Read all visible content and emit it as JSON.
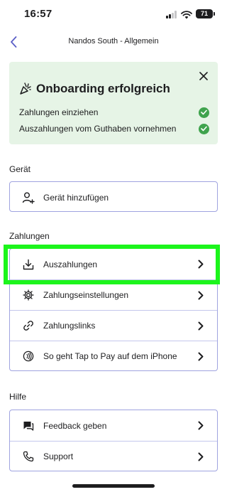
{
  "status_bar": {
    "time": "16:57",
    "battery": "71"
  },
  "nav": {
    "title": "Nandos South - Allgemein"
  },
  "onboarding": {
    "title": "Onboarding erfolgreich",
    "items": [
      {
        "label": "Zahlungen einziehen"
      },
      {
        "label": "Auszahlungen vom Guthaben vornehmen"
      }
    ]
  },
  "sections": {
    "device": {
      "title": "Gerät",
      "items": [
        {
          "label": "Gerät hinzufügen",
          "icon": "add-person-icon"
        }
      ]
    },
    "payments": {
      "title": "Zahlungen",
      "items": [
        {
          "label": "Auszahlungen",
          "icon": "download-tray-icon"
        },
        {
          "label": "Zahlungseinstellungen",
          "icon": "gear-icon"
        },
        {
          "label": "Zahlungslinks",
          "icon": "link-icon"
        },
        {
          "label": "So geht Tap to Pay auf dem iPhone",
          "icon": "contactless-icon"
        }
      ]
    },
    "help": {
      "title": "Hilfe",
      "items": [
        {
          "label": "Feedback geben",
          "icon": "feedback-icon"
        },
        {
          "label": "Support",
          "icon": "phone-icon"
        }
      ]
    }
  },
  "colors": {
    "accent": "#5b5fc7",
    "card_border": "#9fa3e0",
    "banner_bg": "#e6f4e6",
    "check_green": "#3fa34d",
    "highlight": "#1cf51c"
  }
}
